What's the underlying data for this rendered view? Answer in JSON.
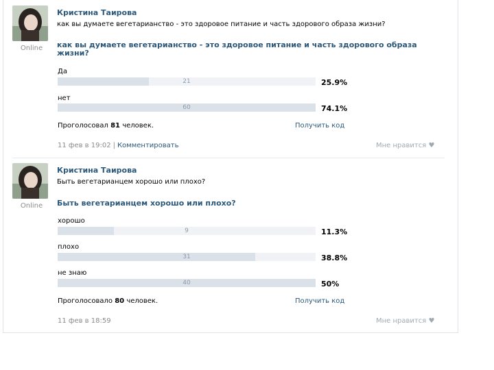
{
  "posts": [
    {
      "author": "Кристина Таирова",
      "status": "Online",
      "text": "как вы думаете вегетарианство - это здоровое питание и часть здорового образа жизни?",
      "poll_title": "как вы думаете вегетарианство - это здоровое питание и часть здорового образа жизни?",
      "options": [
        {
          "label": "Да",
          "count": "21",
          "percent": "25.9%",
          "fraction": 0.353
        },
        {
          "label": "нет",
          "count": "60",
          "percent": "74.1%",
          "fraction": 1.0
        }
      ],
      "voted_prefix": "Проголосовал",
      "voted_count": "81",
      "voted_suffix": "человек.",
      "get_code": "Получить код",
      "date": "11 фев в 19:02",
      "comment": "Комментировать",
      "like": "Мне нравится"
    },
    {
      "author": "Кристина Таирова",
      "status": "Online",
      "text": "Быть вегетарианцем хорошо или плохо?",
      "poll_title": "Быть вегетарианцем хорошо или плохо?",
      "options": [
        {
          "label": "хорошо",
          "count": "9",
          "percent": "11.3%",
          "fraction": 0.217
        },
        {
          "label": "плохо",
          "count": "31",
          "percent": "38.8%",
          "fraction": 0.766
        },
        {
          "label": "не знаю",
          "count": "40",
          "percent": "50%",
          "fraction": 1.0
        }
      ],
      "voted_prefix": "Проголосовало",
      "voted_count": "80",
      "voted_suffix": "человек.",
      "get_code": "Получить код",
      "date": "11 фев в 18:59",
      "like": "Мне нравится"
    }
  ],
  "colors": {
    "link": "#2b587a",
    "bar_track": "#f0f2f5",
    "bar_fill": "#dae1e8"
  }
}
